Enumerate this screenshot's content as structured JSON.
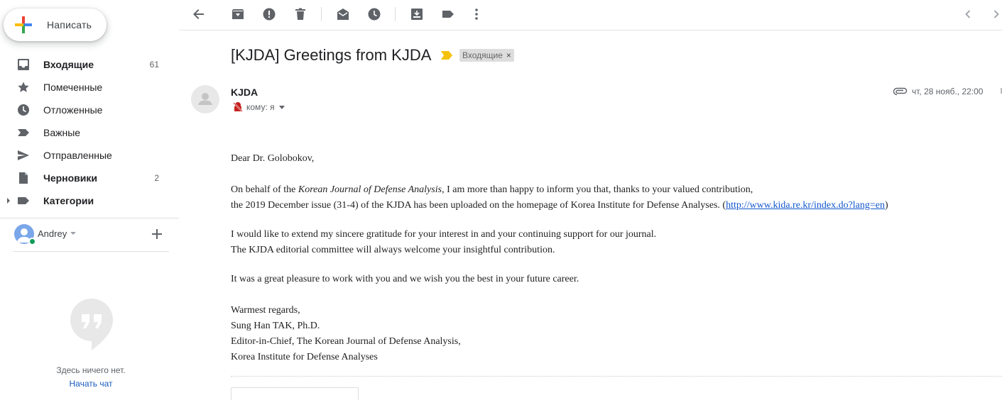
{
  "compose": {
    "label": "Написать"
  },
  "nav": {
    "items": [
      {
        "label": "Входящие",
        "count": "61",
        "icon": "inbox-icon",
        "bold": true
      },
      {
        "label": "Помеченные",
        "count": "",
        "icon": "star-icon",
        "bold": false
      },
      {
        "label": "Отложенные",
        "count": "",
        "icon": "clock-icon",
        "bold": false
      },
      {
        "label": "Важные",
        "count": "",
        "icon": "important-icon",
        "bold": false
      },
      {
        "label": "Отправленные",
        "count": "",
        "icon": "send-icon",
        "bold": false
      },
      {
        "label": "Черновики",
        "count": "2",
        "icon": "draft-icon",
        "bold": true
      },
      {
        "label": "Категории",
        "count": "",
        "icon": "label-icon",
        "bold": true
      }
    ]
  },
  "hangouts": {
    "user_name": "Andrey",
    "empty_text": "Здесь ничего нет.",
    "start_chat": "Начать чат"
  },
  "toolbar": {
    "icons": [
      "back-icon",
      "archive-icon",
      "report-spam-icon",
      "delete-icon",
      "mark-unread-icon",
      "snooze-icon",
      "move-to-icon",
      "labels-icon",
      "more-icon",
      "prev-icon",
      "next-icon"
    ]
  },
  "message": {
    "subject": "[KJDA] Greetings from KJDA",
    "label_chip": "Входящие",
    "label_chip_close": "×",
    "sender": "KJDA",
    "to_text": "кому: я",
    "date": "чт, 28 нояб., 22:00",
    "body": {
      "greeting": "Dear Dr. Golobokov,",
      "p1_pre": "On behalf of the ",
      "p1_journal": "Korean Journal of Defense Analysis",
      "p1_post": ", I am more than happy to inform you that, thanks to your valued contribution,",
      "p1_line2_pre": "the 2019 December issue (31-4) of the KJDA has been uploaded on the homepage of Korea Institute for Defense Analyses. (",
      "p1_link": "http://www.kida.re.kr/index.do?lang=en",
      "p1_line2_post": ")",
      "p2_line1": "I would like to extend my sincere gratitude for your interest in and your continuing support for our journal.",
      "p2_line2": "The KJDA editorial committee will always welcome your insightful contribution.",
      "p3": "It was a great pleasure to work with you and we wish you the best in your future career.",
      "sig1": "Warmest regards,",
      "sig2": "Sung Han TAK, Ph.D.",
      "sig3": "Editor-in-Chief, The Korean Journal of Defense Analysis,",
      "sig4": "Korea Institute for Defense Analyses"
    }
  },
  "colors": {
    "link": "#1155cc",
    "online": "#0f9d58",
    "important": "#f4c20d",
    "start_chat": "#1a5bbd"
  }
}
